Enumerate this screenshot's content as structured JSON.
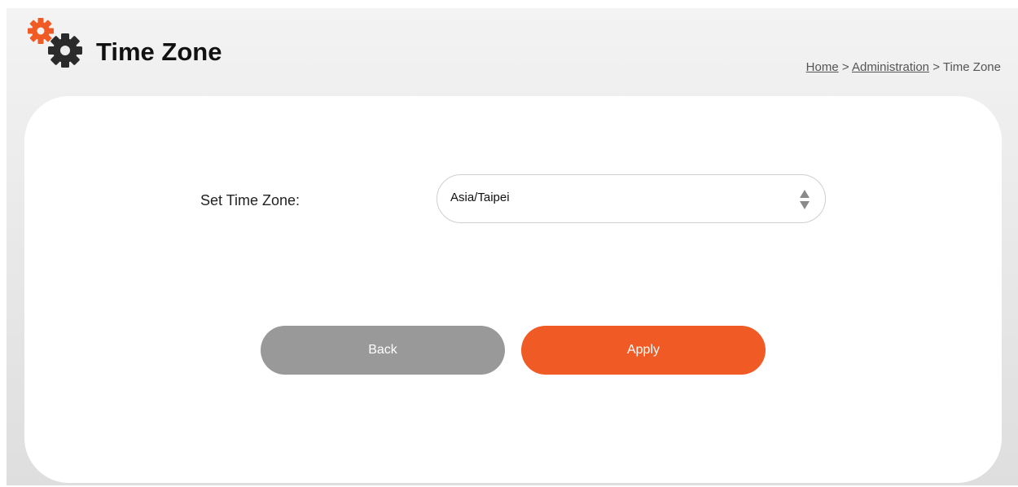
{
  "header": {
    "title": "Time Zone",
    "icon": "gears-icon"
  },
  "breadcrumb": {
    "home": "Home",
    "sep1": ">",
    "administration": "Administration",
    "sep2": ">",
    "current": "Time Zone"
  },
  "form": {
    "label": "Set Time Zone:",
    "selected_value": "Asia/Taipei"
  },
  "buttons": {
    "back": "Back",
    "apply": "Apply"
  },
  "colors": {
    "accent": "#f05a24",
    "back_button": "#999999",
    "gear_dark": "#2b2b2b"
  }
}
